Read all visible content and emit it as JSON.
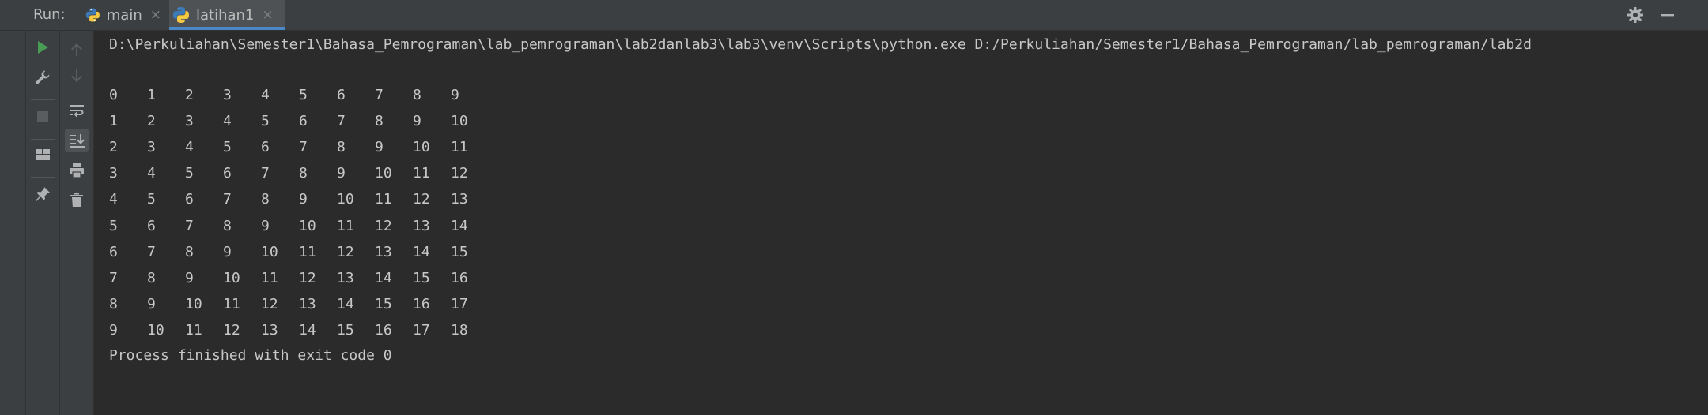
{
  "topbar": {
    "run_label": "Run:",
    "tabs": [
      {
        "label": "main",
        "active": false
      },
      {
        "label": "latihan1",
        "active": true
      }
    ],
    "close_glyph": "×"
  },
  "console": {
    "command": "D:\\Perkuliahan\\Semester1\\Bahasa_Pemrograman\\lab_pemrograman\\lab2danlab3\\lab3\\venv\\Scripts\\python.exe D:/Perkuliahan/Semester1/Bahasa_Pemrograman/lab_pemrograman/lab2d",
    "rows": [
      [
        "0",
        "1",
        "2",
        "3",
        "4",
        "5",
        "6",
        "7",
        "8",
        "9"
      ],
      [
        "1",
        "2",
        "3",
        "4",
        "5",
        "6",
        "7",
        "8",
        "9",
        "10"
      ],
      [
        "2",
        "3",
        "4",
        "5",
        "6",
        "7",
        "8",
        "9",
        "10",
        "11"
      ],
      [
        "3",
        "4",
        "5",
        "6",
        "7",
        "8",
        "9",
        "10",
        "11",
        "12"
      ],
      [
        "4",
        "5",
        "6",
        "7",
        "8",
        "9",
        "10",
        "11",
        "12",
        "13"
      ],
      [
        "5",
        "6",
        "7",
        "8",
        "9",
        "10",
        "11",
        "12",
        "13",
        "14"
      ],
      [
        "6",
        "7",
        "8",
        "9",
        "10",
        "11",
        "12",
        "13",
        "14",
        "15"
      ],
      [
        "7",
        "8",
        "9",
        "10",
        "11",
        "12",
        "13",
        "14",
        "15",
        "16"
      ],
      [
        "8",
        "9",
        "10",
        "11",
        "12",
        "13",
        "14",
        "15",
        "16",
        "17"
      ],
      [
        "9",
        "10",
        "11",
        "12",
        "13",
        "14",
        "15",
        "16",
        "17",
        "18"
      ]
    ],
    "finish": "Process finished with exit code 0"
  },
  "colors": {
    "run_green": "#499c54",
    "python_blue": "#3d7ab8",
    "python_yellow": "#f5c842",
    "tab_underline": "#4a88c7",
    "icon_gray": "#afb1b3"
  },
  "icons": {
    "toolbar": [
      "run-icon",
      "wrench-icon",
      "stop-icon",
      "layout-icon",
      "pin-icon"
    ],
    "toolbar2": [
      "arrow-up-icon",
      "arrow-down-icon",
      "soft-wrap-icon",
      "scroll-to-end-icon",
      "print-icon",
      "trash-icon"
    ],
    "top_right": [
      "gear-icon",
      "minimize-icon"
    ]
  }
}
